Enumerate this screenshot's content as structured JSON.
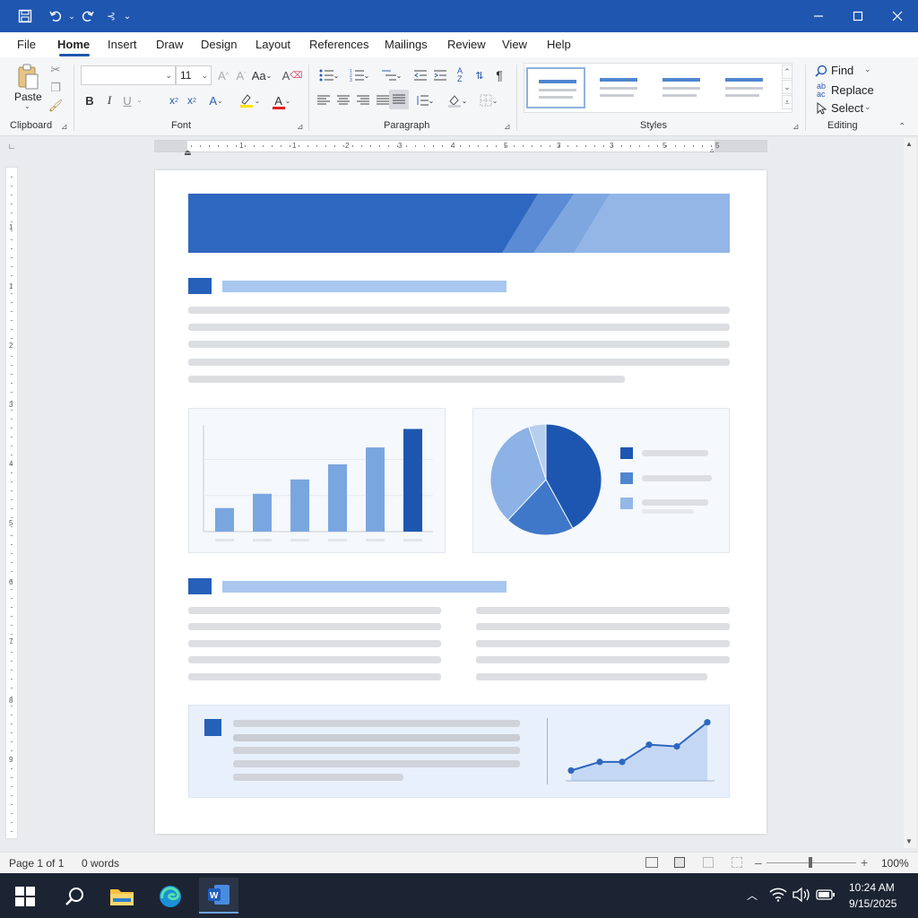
{
  "titlebar": {
    "quick_access": [
      "save-icon",
      "undo-icon",
      "redo-icon",
      "touch-mode-icon",
      "customize-icon"
    ],
    "window_controls": [
      "minimize-icon",
      "maximize-icon",
      "close-icon"
    ]
  },
  "menu": {
    "tabs": [
      "File",
      "Home",
      "Insert",
      "Draw",
      "Design",
      "Layout",
      "References",
      "Mailings",
      "Review",
      "View",
      "Help"
    ],
    "active": "Home"
  },
  "ribbon": {
    "clipboard": {
      "label": "Clipboard",
      "paste_label": "Paste"
    },
    "font": {
      "label": "Font",
      "font_name": "",
      "font_size": "11",
      "bold": "B",
      "italic": "I",
      "underline": "U",
      "font_color_letter": "A"
    },
    "paragraph": {
      "label": "Paragraph"
    },
    "styles": {
      "label": "Styles"
    },
    "editing": {
      "label": "Editing",
      "find": "Find",
      "replace": "Replace",
      "select": "Select"
    }
  },
  "ruler": {
    "top_numbers": [
      "1",
      "1",
      "2",
      "3",
      "4",
      "5",
      "3",
      "3",
      "5",
      "5"
    ],
    "left_numbers": [
      "1",
      "1",
      "2",
      "3",
      "4",
      "5",
      "6",
      "7",
      "8",
      "9"
    ]
  },
  "document": {
    "bar_chart": {
      "values": [
        28,
        45,
        62,
        80,
        100,
        122
      ],
      "ymax": 130
    },
    "pie_chart": {
      "slices": [
        42,
        20,
        33,
        5
      ]
    },
    "line_chart": {
      "values": [
        12,
        22,
        22,
        42,
        40,
        68
      ],
      "ymax": 75
    }
  },
  "status": {
    "page": "Page 1 of 1",
    "words": "0 words",
    "zoom": "100%"
  },
  "taskbar": {
    "time": "10:24 AM",
    "date": "9/15/2025"
  },
  "colors": {
    "accent": "#1f56b0",
    "chart_dark": "#1d56b0",
    "chart_light": "#7aa6e0"
  }
}
